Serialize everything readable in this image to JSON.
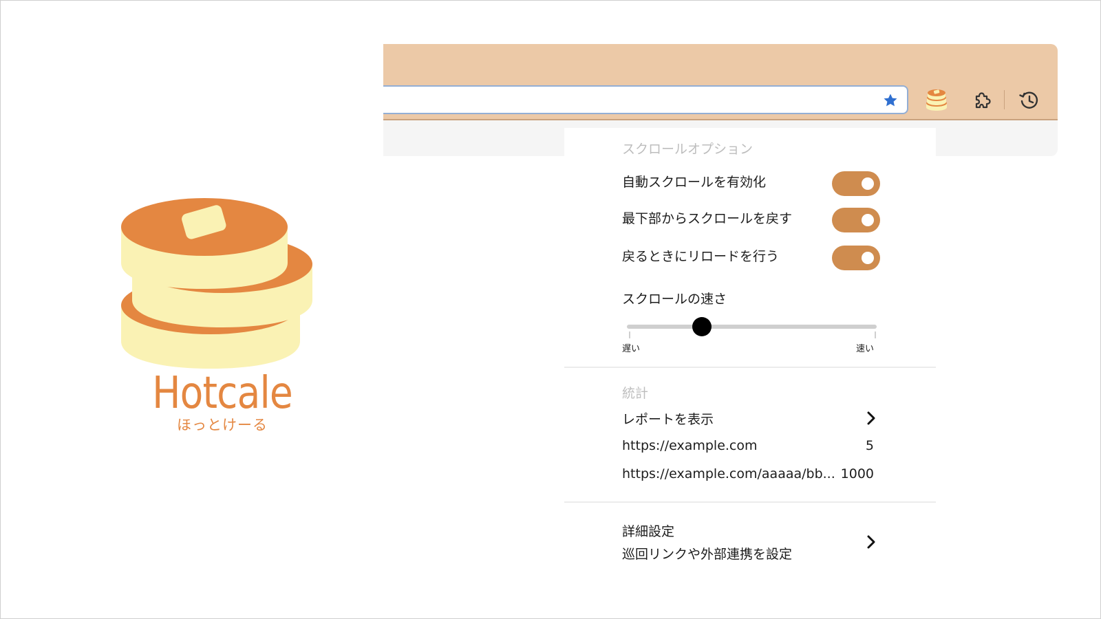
{
  "logo": {
    "word": "Hotcale",
    "kana": "ほっとけーる"
  },
  "browser": {
    "address_bar_value": "",
    "toolbar_icons": [
      "star-icon",
      "pancake-extension-icon",
      "puzzle-icon",
      "history-icon"
    ]
  },
  "popup": {
    "scroll_section_title": "スクロールオプション",
    "options": [
      {
        "label": "自動スクロールを有効化",
        "enabled": true
      },
      {
        "label": "最下部からスクロールを戻す",
        "enabled": true
      },
      {
        "label": "戻るときにリロードを行う",
        "enabled": true
      }
    ],
    "speed": {
      "label": "スクロールの速さ",
      "min_label": "遅い",
      "max_label": "速い",
      "value_fraction": 0.3
    },
    "stats_section_title": "統計",
    "report_link_label": "レポートを表示",
    "stats": [
      {
        "url": "https://example.com",
        "count": "5"
      },
      {
        "url": "https://example.com/aaaaa/bb...",
        "count": "1000"
      }
    ],
    "advanced": {
      "title": "詳細設定",
      "subtitle": "巡回リンクや外部連携を設定"
    }
  },
  "colors": {
    "brand_orange": "#e48741",
    "toggle_on": "#cf8c4f",
    "toolbar_bg": "#ecc9a7",
    "star_blue": "#2f6fd0"
  }
}
